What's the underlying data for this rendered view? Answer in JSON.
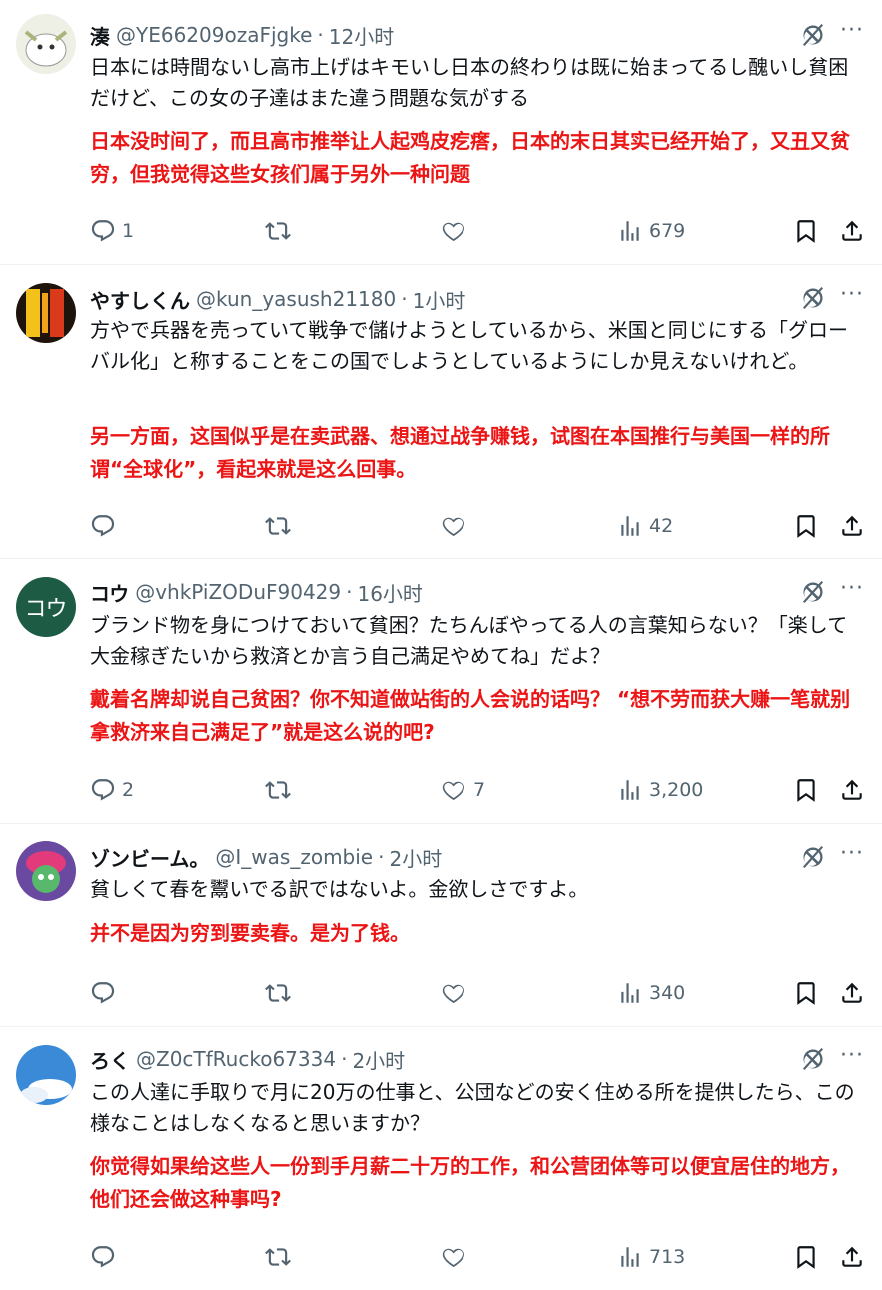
{
  "tweets": [
    {
      "name": "湊",
      "handle": "@YE66209ozaFjgke",
      "separator": "·",
      "time": "12小时",
      "jp": "日本には時間ないし高市上げはキモいし日本の終わりは既に始まってるし醜いし貧困だけど、この女の子達はまた違う問題な気がする",
      "cn": "日本没时间了，而且高市推举让人起鸡皮疙瘩，日本的末日其实已经开始了，又丑又贫穷，但我觉得这些女孩们属于另外一种问题",
      "replies": "1",
      "likes": "",
      "views": "679",
      "avatar_color": "#e9ece2"
    },
    {
      "name": "やすしくん",
      "handle": "@kun_yasush21180",
      "separator": "·",
      "time": "1小时",
      "jp": "方やで兵器を売っていて戦争で儲けようとしているから、米国と同じにする「グローバル化」と称することをこの国でしようとしているようにしか見えないけれど。",
      "cn": "另一方面，这国似乎是在卖武器、想通过战争赚钱，试图在本国推行与美国一样的所谓“全球化”，看起来就是这么回事。",
      "replies": "",
      "likes": "",
      "views": "42",
      "avatar_color": "#2a1b10"
    },
    {
      "name": "コウ",
      "handle": "@vhkPiZODuF90429",
      "separator": "·",
      "time": "16小时",
      "jp": "ブランド物を身につけておいて貧困？たちんぼやってる人の言葉知らない？「楽して大金稼ぎたいから救済とか言う自己満足やめてね」だよ？",
      "cn": "戴着名牌却说自己贫困？你不知道做站街的人会说的话吗？ “想不劳而获大赚一笔就别拿救济来自己满足了”就是这么说的吧?",
      "replies": "2",
      "likes": "7",
      "views": "3,200",
      "avatar_text": "コウ",
      "avatar_color": "#1d5b45"
    },
    {
      "name": "ゾンビーム。",
      "handle": "@I_was_zombie",
      "separator": "·",
      "time": "2小时",
      "jp": "貧しくて春を鬻いでる訳ではないよ。金欲しさですよ。",
      "cn": "并不是因为穷到要卖春。是为了钱。",
      "replies": "",
      "likes": "",
      "views": "340",
      "avatar_color": "#5c3a8c"
    },
    {
      "name": "ろく",
      "handle": "@Z0cTfRucko67334",
      "separator": "·",
      "time": "2小时",
      "jp": "この人達に手取りで月に20万の仕事と、公団などの安く住める所を提供したら、この様なことはしなくなると思いますか？",
      "cn": "你觉得如果给这些人一份到手月薪二十万的工作，和公营团体等可以便宜居住的地方，他们还会做这种事吗?",
      "replies": "",
      "likes": "",
      "views": "713",
      "avatar_color": "#2f7fd0"
    }
  ],
  "more_glyph": "···",
  "icons": [
    "reply-icon",
    "retweet-icon",
    "like-icon",
    "views-icon",
    "bookmark-icon",
    "share-icon",
    "grok-icon"
  ]
}
